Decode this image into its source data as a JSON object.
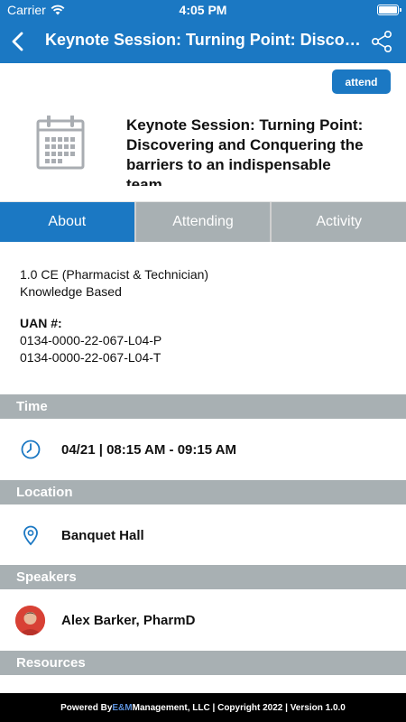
{
  "status_bar": {
    "carrier": "Carrier",
    "time": "4:05 PM"
  },
  "nav": {
    "title": "Keynote Session: Turning Point: Discovering and Conquering the barriers to an indispensable team",
    "back_icon": "chevron-left-icon",
    "share_icon": "share-icon"
  },
  "attend_label": "attend",
  "session": {
    "title": "Keynote Session: Turning Point: Discovering and Conquering the barriers to an indispensable team",
    "icon": "calendar-icon"
  },
  "tabs": [
    {
      "label": "About"
    },
    {
      "label": "Attending"
    },
    {
      "label": "Activity"
    }
  ],
  "about": {
    "ce_line": "1.0 CE (Pharmacist & Technician)",
    "type_line": "Knowledge Based",
    "uan_label": "UAN #:",
    "uan_values": [
      "0134-0000-22-067-L04-P",
      "0134-0000-22-067-L04-T"
    ]
  },
  "sections": {
    "time": {
      "header": "Time",
      "value": "04/21 | 08:15 AM - 09:15 AM",
      "icon": "clock-icon"
    },
    "location": {
      "header": "Location",
      "value": "Banquet Hall",
      "icon": "map-pin-icon"
    },
    "speakers": {
      "header": "Speakers",
      "value": "Alex Barker, PharmD"
    },
    "resources": {
      "header": "Resources"
    }
  },
  "footer": {
    "prefix": "Powered By ",
    "brand": "E&M",
    "suffix": " Management, LLC | Copyright 2022 | Version 1.0.0"
  },
  "colors": {
    "primary": "#1b78c3",
    "section_gray": "#a8b0b3"
  }
}
